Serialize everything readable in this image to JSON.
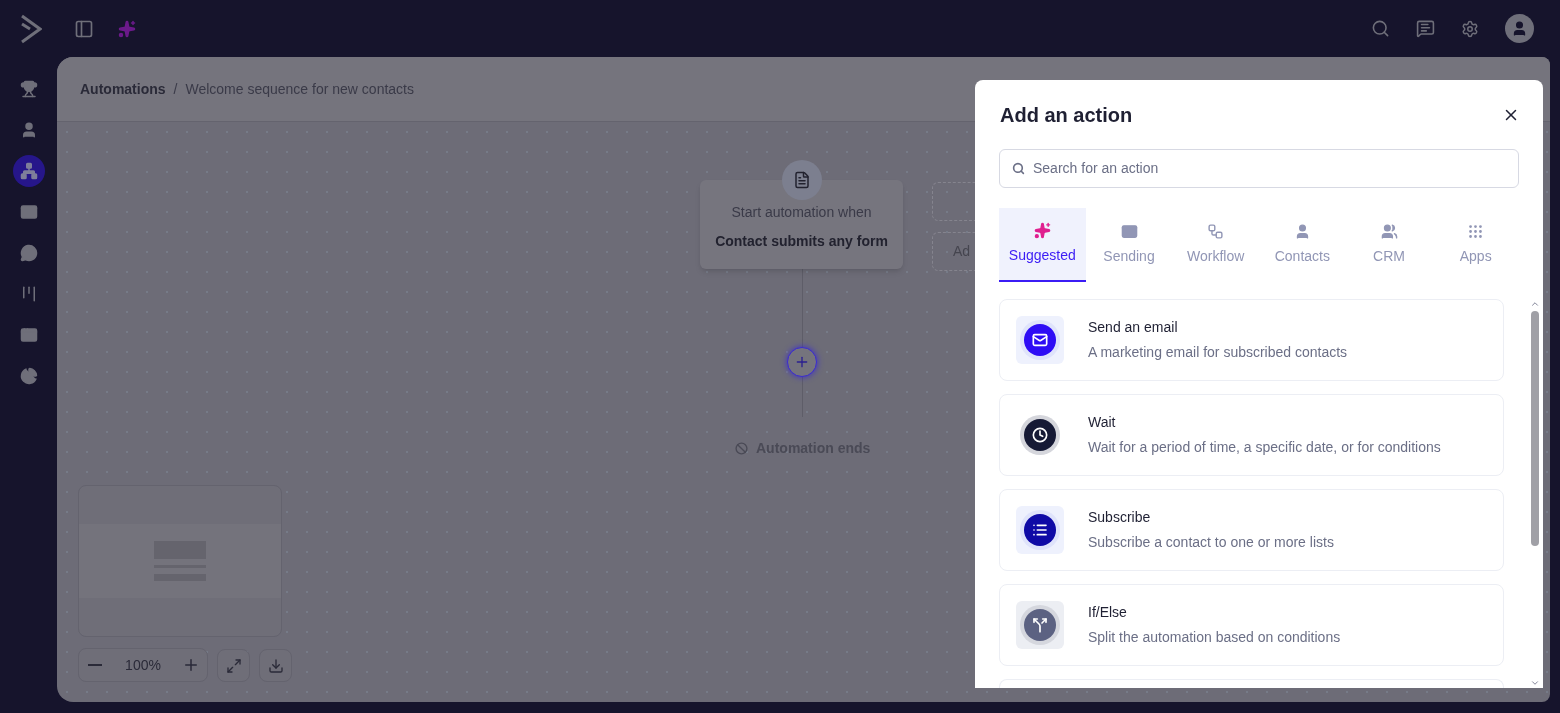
{
  "sidebar": {
    "items": [
      {
        "selected": false
      },
      {
        "selected": false
      },
      {
        "selected": true
      },
      {
        "selected": false
      },
      {
        "selected": false
      },
      {
        "selected": false
      },
      {
        "selected": false
      },
      {
        "selected": false
      }
    ]
  },
  "breadcrumb": {
    "root": "Automations",
    "separator": "/",
    "current": "Welcome sequence for new contacts"
  },
  "canvas": {
    "trigger": {
      "label": "Start automation when",
      "value": "Contact submits any form"
    },
    "end_label": "Automation ends",
    "add_box_text": "Ad",
    "zoom": "100%"
  },
  "modal": {
    "title": "Add an action",
    "search": {
      "placeholder": "Search for an action"
    },
    "tabs": [
      {
        "label": "Suggested",
        "selected": true
      },
      {
        "label": "Sending",
        "selected": false
      },
      {
        "label": "Workflow",
        "selected": false
      },
      {
        "label": "Contacts",
        "selected": false
      },
      {
        "label": "CRM",
        "selected": false
      },
      {
        "label": "Apps",
        "selected": false
      }
    ],
    "actions": [
      {
        "kind": "email",
        "title": "Send an email",
        "description": "A marketing email for subscribed contacts"
      },
      {
        "kind": "wait",
        "title": "Wait",
        "description": "Wait for a period of time, a specific date, or for conditions"
      },
      {
        "kind": "subscribe",
        "title": "Subscribe",
        "description": "Subscribe a contact to one or more lists"
      },
      {
        "kind": "ifelse",
        "title": "If/Else",
        "description": "Split the automation based on conditions"
      },
      {
        "kind": "more"
      }
    ]
  }
}
